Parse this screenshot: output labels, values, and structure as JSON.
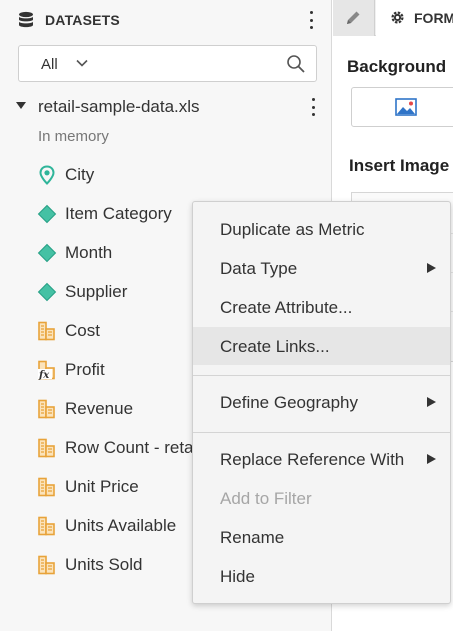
{
  "datasets_panel": {
    "title": "DATASETS",
    "filter": {
      "selected": "All"
    },
    "dataset": {
      "name": "retail-sample-data.xls",
      "status": "In memory"
    },
    "fields": [
      {
        "label": "City",
        "type": "geo-attribute",
        "icon": "map-pin-icon"
      },
      {
        "label": "Item Category",
        "type": "attribute",
        "icon": "attribute-diamond-icon"
      },
      {
        "label": "Month",
        "type": "attribute",
        "icon": "attribute-diamond-icon"
      },
      {
        "label": "Supplier",
        "type": "attribute",
        "icon": "attribute-diamond-icon"
      },
      {
        "label": "Cost",
        "type": "metric",
        "icon": "metric-icon"
      },
      {
        "label": "Profit",
        "type": "derived-metric",
        "icon": "fx-metric-icon"
      },
      {
        "label": "Revenue",
        "type": "metric",
        "icon": "metric-icon"
      },
      {
        "label": "Row Count - retail-sample-data.xls",
        "type": "metric",
        "icon": "metric-icon"
      },
      {
        "label": "Unit Price",
        "type": "metric",
        "icon": "metric-icon"
      },
      {
        "label": "Units Available",
        "type": "metric",
        "icon": "metric-icon"
      },
      {
        "label": "Units Sold",
        "type": "metric",
        "icon": "metric-icon"
      }
    ]
  },
  "format_panel": {
    "tab_label": "FORMAT",
    "background_heading": "Background",
    "insert_image_heading": "Insert Image"
  },
  "context_menu": {
    "items": [
      {
        "label": "Duplicate as Metric",
        "submenu": false,
        "disabled": false
      },
      {
        "label": "Data Type",
        "submenu": true,
        "disabled": false
      },
      {
        "label": "Create Attribute...",
        "submenu": false,
        "disabled": false
      },
      {
        "label": "Create Links...",
        "submenu": false,
        "disabled": false,
        "highlighted": true
      },
      {
        "label": "Define Geography",
        "submenu": true,
        "disabled": false
      },
      {
        "label": "Replace Reference With",
        "submenu": true,
        "disabled": false
      },
      {
        "label": "Add to Filter",
        "submenu": false,
        "disabled": true
      },
      {
        "label": "Rename",
        "submenu": false,
        "disabled": false
      },
      {
        "label": "Hide",
        "submenu": false,
        "disabled": false
      }
    ]
  },
  "colors": {
    "attribute_teal": "#2fb59a",
    "metric_orange": "#e8a33a",
    "panel_bg": "#f7f7f7",
    "menu_bg": "#f4f4f4",
    "menu_highlight": "#e6e6e6",
    "disabled_text": "#a6a6a6"
  }
}
